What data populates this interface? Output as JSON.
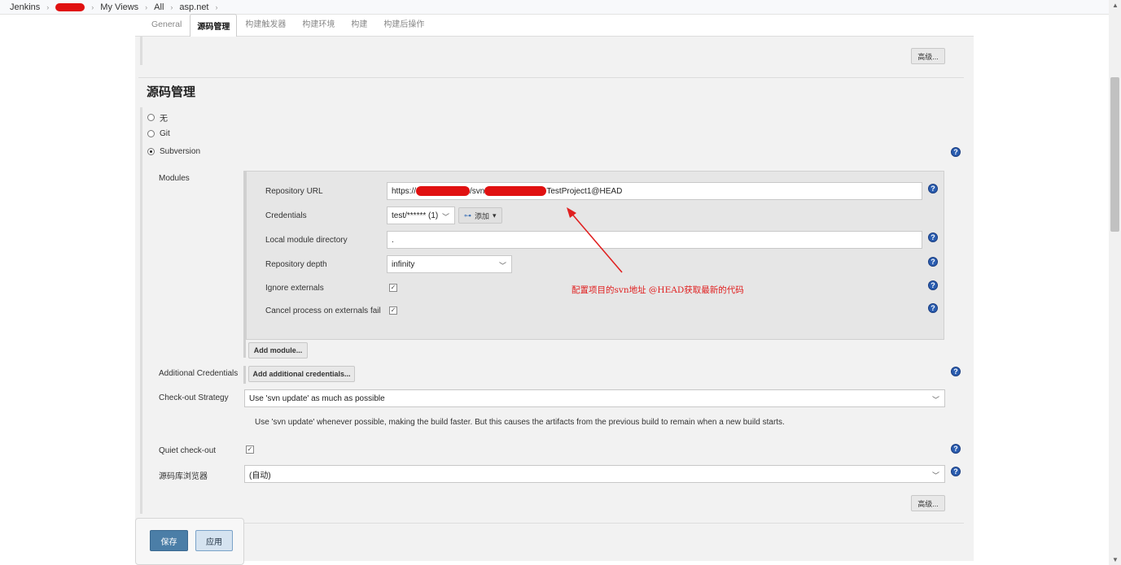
{
  "breadcrumb": {
    "items": [
      "Jenkins",
      "My Views",
      "All",
      "asp.net"
    ]
  },
  "tabs": {
    "general": "General",
    "scm": "源码管理",
    "triggers": "构建触发器",
    "env": "构建环境",
    "build": "构建",
    "post": "构建后操作"
  },
  "advanced_label": "高级...",
  "scm": {
    "title": "源码管理",
    "options": [
      "无",
      "Git",
      "Subversion"
    ],
    "selected": "Subversion"
  },
  "modules": {
    "label": "Modules",
    "repo_url_label": "Repository URL",
    "repo_url_prefix": "https://",
    "repo_url_mid": "/svn",
    "repo_url_suffix": "TestProject1@HEAD",
    "credentials_label": "Credentials",
    "credentials_value": "test/****** (1)",
    "add_label": "添加",
    "local_dir_label": "Local module directory",
    "local_dir_value": ".",
    "depth_label": "Repository depth",
    "depth_value": "infinity",
    "ignore_label": "Ignore externals",
    "cancel_label": "Cancel process on externals fail",
    "add_module": "Add module..."
  },
  "annotation": "配置项目的svn地址  @HEAD获取最新的代码",
  "additional": {
    "label": "Additional Credentials",
    "button": "Add additional credentials..."
  },
  "checkout": {
    "label": "Check-out Strategy",
    "value": "Use 'svn update' as much as possible",
    "description": "Use 'svn update' whenever possible, making the build faster. But this causes the artifacts from the previous build to remain when a new build starts."
  },
  "quiet_label": "Quiet check-out",
  "browser": {
    "label": "源码库浏览器",
    "value": "(自动)"
  },
  "footer": {
    "save": "保存",
    "apply": "应用"
  },
  "colors": {
    "redaction": "#e01010",
    "annotation": "#e02020",
    "save_button": "#4b7ea7",
    "help_icon": "#2a5db0"
  }
}
